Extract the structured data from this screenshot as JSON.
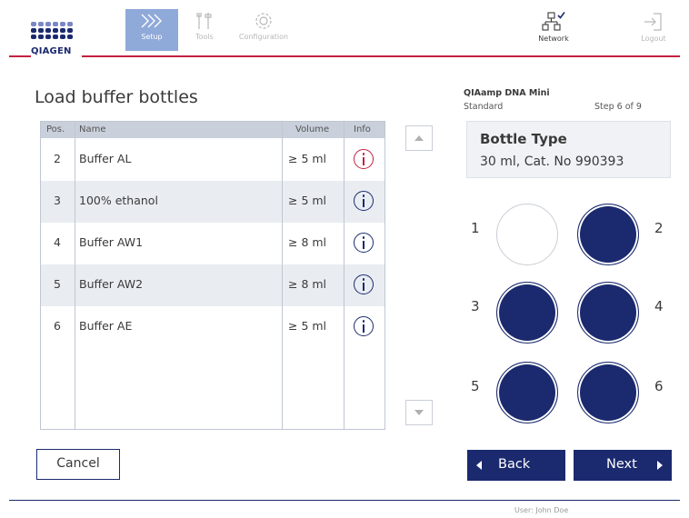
{
  "header": {
    "logo_text": "QIAGEN",
    "nav": [
      {
        "label": "Setup",
        "icon": "setup-icon",
        "active": true
      },
      {
        "label": "Tools",
        "icon": "tools-icon",
        "active": false
      },
      {
        "label": "Configuration",
        "icon": "configuration-icon",
        "active": false
      },
      {
        "label": "Network",
        "icon": "network-icon",
        "active": false
      },
      {
        "label": "Logout",
        "icon": "logout-icon",
        "active": false
      }
    ]
  },
  "page_title": "Load buffer bottles",
  "table": {
    "columns": [
      "Pos.",
      "Name",
      "Volume",
      "Info"
    ],
    "rows": [
      {
        "pos": "2",
        "name": "Buffer AL",
        "volume": "≥ 5 ml",
        "info_color": "#c4203e"
      },
      {
        "pos": "3",
        "name": "100% ethanol",
        "volume": "≥ 5 ml",
        "info_color": "#1b2a6e"
      },
      {
        "pos": "4",
        "name": "Buffer AW1",
        "volume": "≥ 8 ml",
        "info_color": "#1b2a6e"
      },
      {
        "pos": "5",
        "name": "Buffer AW2",
        "volume": "≥ 8 ml",
        "info_color": "#1b2a6e"
      },
      {
        "pos": "6",
        "name": "Buffer AE",
        "volume": "≥ 5 ml",
        "info_color": "#1b2a6e"
      }
    ]
  },
  "protocol": {
    "name": "QIAamp DNA Mini",
    "mode": "Standard",
    "step": "Step 6 of 9"
  },
  "bottle_type": {
    "title": "Bottle Type",
    "value": "30 ml, Cat. No 990393"
  },
  "positions": [
    {
      "label": "1",
      "filled": false
    },
    {
      "label": "2",
      "filled": true
    },
    {
      "label": "3",
      "filled": true
    },
    {
      "label": "4",
      "filled": true
    },
    {
      "label": "5",
      "filled": true
    },
    {
      "label": "6",
      "filled": true
    }
  ],
  "buttons": {
    "cancel": "Cancel",
    "back": "Back",
    "next": "Next"
  },
  "footer": {
    "user": "User: John Doe"
  },
  "colors": {
    "brand_navy": "#1b2a6e",
    "accent_red": "#c4203e",
    "active_tab": "#8fa9d9"
  }
}
